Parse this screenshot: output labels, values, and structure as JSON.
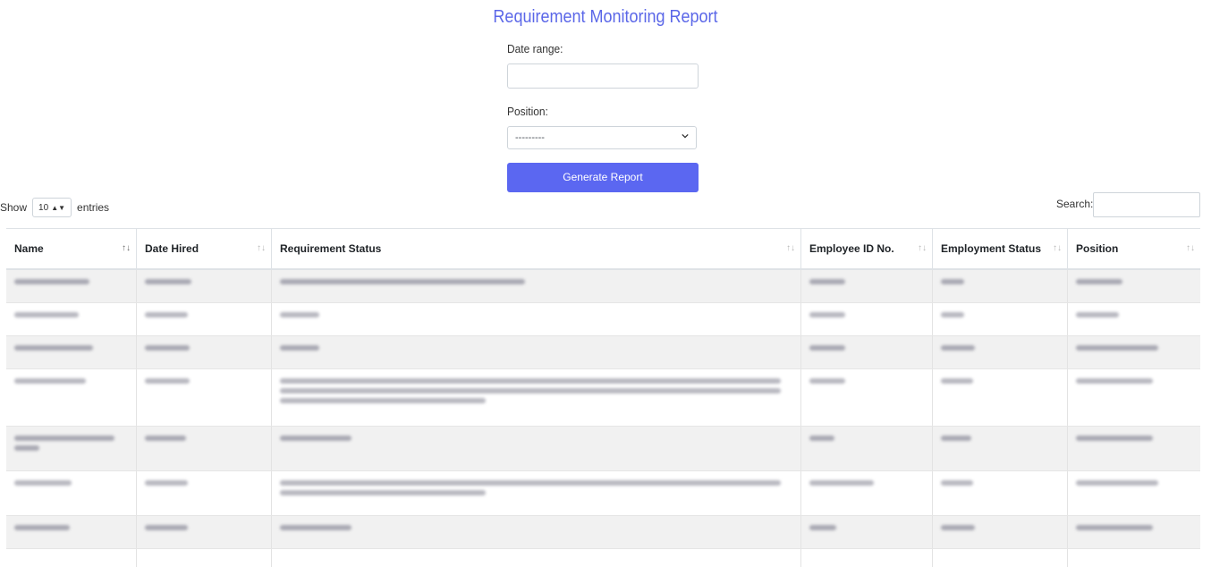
{
  "page": {
    "title": "Requirement Monitoring Report"
  },
  "form": {
    "date_range_label": "Date range:",
    "date_range_value": "",
    "position_label": "Position:",
    "position_selected": "---------",
    "generate_button": "Generate Report"
  },
  "table_controls": {
    "show_label": "Show",
    "entries_value": "10",
    "entries_label": "entries",
    "search_label": "Search:",
    "search_value": ""
  },
  "table": {
    "columns": [
      "Name",
      "Date Hired",
      "Requirement Status",
      "Employee ID No.",
      "Employment Status",
      "Position"
    ],
    "sort_glyph": "↑↓",
    "rows_note_blurred": true
  },
  "colors": {
    "accent": "#5b67f1",
    "title": "#5b67e8"
  }
}
